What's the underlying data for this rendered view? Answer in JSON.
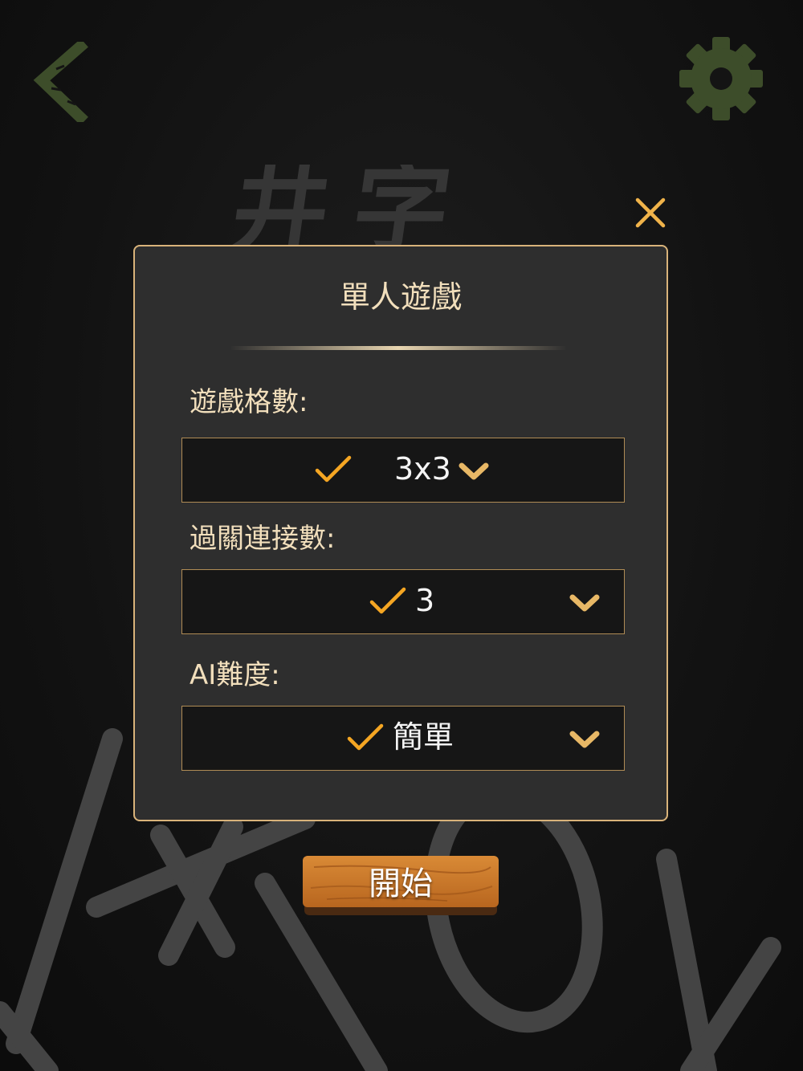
{
  "background": {
    "title_chars": "井字"
  },
  "nav": {
    "back_icon": "chevron-left-icon",
    "settings_icon": "gear-icon"
  },
  "dialog": {
    "close_icon": "close-icon",
    "title": "單人遊戲",
    "grid": {
      "label": "遊戲格數:",
      "value": "3x3"
    },
    "win_length": {
      "label": "過關連接數:",
      "value": "3"
    },
    "ai_difficulty": {
      "label": "AI難度:",
      "value": "簡單"
    }
  },
  "start_button": {
    "label": "開始"
  },
  "colors": {
    "accent_gold": "#d9b37a",
    "check_orange": "#f5a623",
    "icon_green": "#3d4d2a",
    "close_orange": "#f0b34a",
    "panel": "#2e2e2e",
    "field": "#161616"
  }
}
